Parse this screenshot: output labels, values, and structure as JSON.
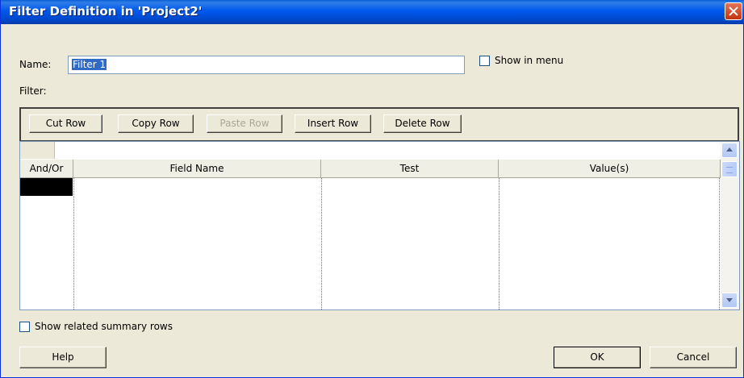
{
  "window": {
    "title": "Filter Definition in 'Project2'"
  },
  "name_label": "Name:",
  "name_value": "Filter 1",
  "show_in_menu_label": "Show in menu",
  "filter_label": "Filter:",
  "toolbar": {
    "cut_row": "Cut Row",
    "copy_row": "Copy Row",
    "paste_row": "Paste Row",
    "insert_row": "Insert Row",
    "delete_row": "Delete Row"
  },
  "grid": {
    "columns": [
      "And/Or",
      "Field Name",
      "Test",
      "Value(s)"
    ],
    "rows": []
  },
  "show_related_label": "Show related summary rows",
  "buttons": {
    "help": "Help",
    "ok": "OK",
    "cancel": "Cancel"
  }
}
